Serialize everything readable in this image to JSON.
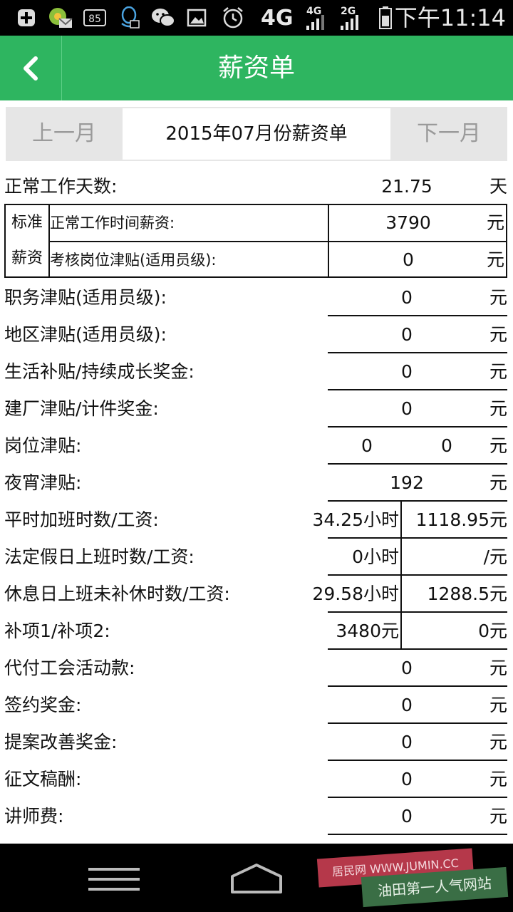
{
  "status_bar": {
    "battery_level": "85",
    "network_main": "4G",
    "network_4g": "4G",
    "network_2g": "2G",
    "time": "下午11:14",
    "icons": [
      "plus-icon",
      "app-badge-icon",
      "battery-85-icon",
      "qq-icon",
      "wechat-icon",
      "image-icon",
      "alarm-icon",
      "signal-4g-icon",
      "signal-2g-icon",
      "battery-icon"
    ]
  },
  "header": {
    "title": "薪资单",
    "back_icon": "chevron-left-icon"
  },
  "month_switcher": {
    "prev": "上一月",
    "current": "2015年07月份薪资单",
    "next": "下一月"
  },
  "work_days": {
    "label": "正常工作天数:",
    "value": "21.75",
    "unit": "天"
  },
  "standard_wage": {
    "group_label_1": "标准",
    "group_label_2": "薪资",
    "rows": [
      {
        "label": "正常工作时间薪资:",
        "value": "3790",
        "unit": "元"
      },
      {
        "label": "考核岗位津贴(适用员级):",
        "value": "0",
        "unit": "元"
      }
    ]
  },
  "rows": [
    {
      "label": "职务津贴(适用员级):",
      "value": "0",
      "unit": "元"
    },
    {
      "label": "地区津贴(适用员级):",
      "value": "0",
      "unit": "元"
    },
    {
      "label": "生活补贴/持续成长奖金:",
      "value": "0",
      "unit": "元"
    },
    {
      "label": "建厂津贴/计件奖金:",
      "value": "0",
      "unit": "元"
    },
    {
      "label": "岗位津贴:",
      "value": "0",
      "value2": "0",
      "unit": "元"
    },
    {
      "label": "夜宵津贴:",
      "value": "192",
      "unit": "元"
    }
  ],
  "split_rows": [
    {
      "label": "平时加班时数/工资:",
      "left": "34.25小时",
      "right": "1118.95元"
    },
    {
      "label": "法定假日上班时数/工资:",
      "left": "0小时",
      "right": "/元"
    },
    {
      "label": "休息日上班未补休时数/工资:",
      "left": "29.58小时",
      "right": "1288.5元"
    },
    {
      "label": "补项1/补项2:",
      "left": "3480元",
      "right": "0元"
    }
  ],
  "tail_rows": [
    {
      "label": "代付工会活动款:",
      "value": "0",
      "unit": "元"
    },
    {
      "label": "签约奖金:",
      "value": "0",
      "unit": "元"
    },
    {
      "label": "提案改善奖金:",
      "value": "0",
      "unit": "元"
    },
    {
      "label": "征文稿酬:",
      "value": "0",
      "unit": "元"
    },
    {
      "label": "讲师费:",
      "value": "0",
      "unit": "元"
    }
  ],
  "nav_bar": {
    "menu_icon": "menu-icon",
    "home_icon": "home-icon"
  },
  "watermark": {
    "line1": "居民网 WWW.JUMIN.CC",
    "line2": "油田第一人气网站"
  }
}
